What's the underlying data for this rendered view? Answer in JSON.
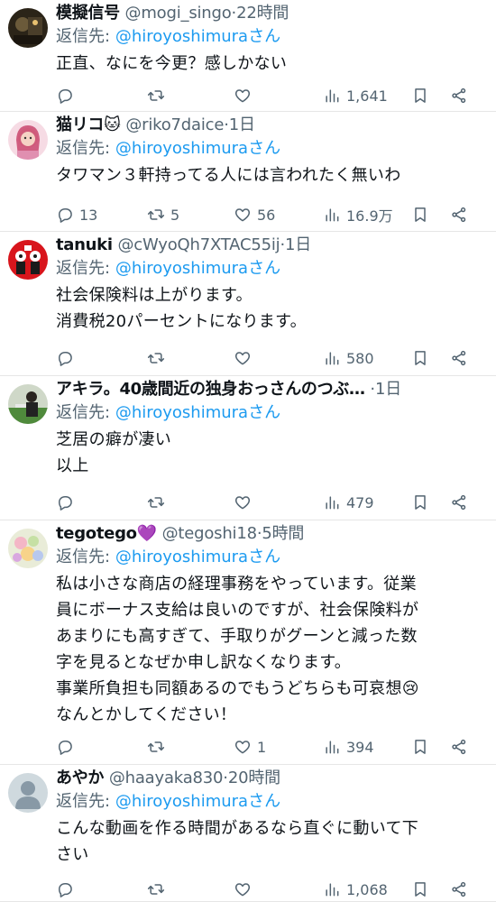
{
  "reply_prefix": "返信先:",
  "reply_suffix": "さん",
  "tweets": [
    {
      "name": "模擬信号",
      "handle": "@mogi_singo",
      "time": "22時間",
      "mention": "@hiroyoshimura",
      "lines": [
        "正直、なにを今更？感しかない"
      ],
      "replies": "",
      "retweets": "",
      "likes": "",
      "views": "1,641",
      "avatar": "dark-photo"
    },
    {
      "name": "猫リコ🐱",
      "handle": "@riko7daice",
      "time": "1日",
      "mention": "@hiroyoshimura",
      "lines": [
        "タワマン３軒持ってる人には言われたく無いわ"
      ],
      "replies": "13",
      "retweets": "5",
      "likes": "56",
      "views": "16.9万",
      "avatar": "pink-photo"
    },
    {
      "name": "tanuki",
      "handle": "@cWyoQh7XTAC55ij",
      "time": "1日",
      "mention": "@hiroyoshimura",
      "lines": [
        "社会保険料は上がります。",
        "消費税20パーセントになります。"
      ],
      "replies": "",
      "retweets": "",
      "likes": "",
      "views": "580",
      "avatar": "red-illustration"
    },
    {
      "name": "アキラ。40歳間近の独身おっさんのつぶ…",
      "handle": "",
      "time": "1日",
      "mention": "@hiroyoshimura",
      "lines": [
        "芝居の癖が凄い",
        "以上"
      ],
      "replies": "",
      "retweets": "",
      "likes": "",
      "views": "479",
      "avatar": "green-photo"
    },
    {
      "name": "tegotego💜",
      "handle": "@tegoshi18",
      "time": "5時間",
      "mention": "@hiroyoshimura",
      "lines": [
        "私は小さな商店の経理事務をやっています。従業",
        "員にボーナス支給は良いのですが、社会保険料が",
        "あまりにも高すぎて、手取りがグーンと減った数",
        "字を見るとなぜか申し訳なくなります。",
        "事業所負担も同額あるのでもうどちらも可哀想😢",
        "なんとかしてください！"
      ],
      "replies": "",
      "retweets": "",
      "likes": "1",
      "views": "394",
      "avatar": "flower-photo"
    },
    {
      "name": "あやか",
      "handle": "@haayaka830",
      "time": "20時間",
      "mention": "@hiroyoshimura",
      "lines": [
        "こんな動画を作る時間があるなら直ぐに動いて下",
        "さい"
      ],
      "replies": "",
      "retweets": "",
      "likes": "",
      "views": "1,068",
      "avatar": "default-avatar"
    }
  ]
}
